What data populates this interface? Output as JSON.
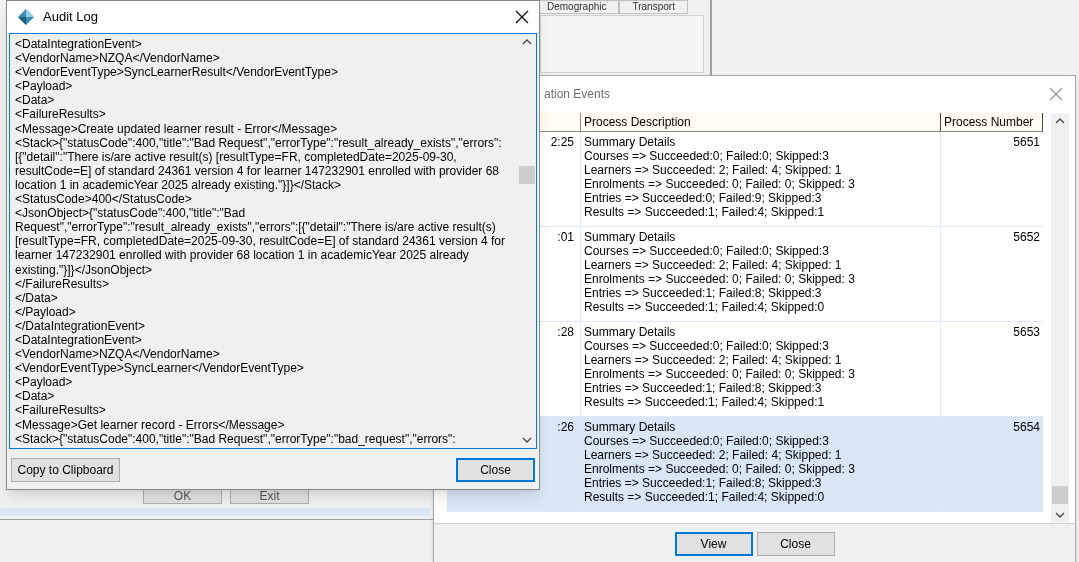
{
  "background": {
    "tabs": [
      "Demographic",
      "Transport"
    ],
    "buttons": [
      "OK",
      "Exit"
    ]
  },
  "events_window": {
    "title": "ation Events",
    "columns": [
      "Process Description",
      "Process Number"
    ],
    "rows": [
      {
        "time": "2:25",
        "title": "Summary Details",
        "details": [
          "Courses => Succeeded:0; Failed:0; Skipped:3",
          "Learners => Succeeded: 2; Failed: 4; Skipped: 1",
          "Enrolments => Succeeded: 0; Failed: 0; Skipped: 3",
          "Entries => Succeeded:0; Failed:9; Skipped:3",
          "Results => Succeeded:1; Failed:4; Skipped:1"
        ],
        "process_number": "5651",
        "selected": false
      },
      {
        "time": ":01",
        "title": "Summary Details",
        "details": [
          "Courses => Succeeded:0; Failed:0; Skipped:3",
          "Learners => Succeeded: 2; Failed: 4; Skipped: 1",
          "Enrolments => Succeeded: 0; Failed: 0; Skipped: 3",
          "Entries => Succeeded:1; Failed:8; Skipped:3",
          "Results => Succeeded:1; Failed:4; Skipped:0"
        ],
        "process_number": "5652",
        "selected": false
      },
      {
        "time": ":28",
        "title": "Summary Details",
        "details": [
          "Courses => Succeeded:0; Failed:0; Skipped:3",
          "Learners => Succeeded: 2; Failed: 4; Skipped: 1",
          "Enrolments => Succeeded: 0; Failed: 0; Skipped: 3",
          "Entries => Succeeded:1; Failed:8; Skipped:3",
          "Results => Succeeded:1; Failed:4; Skipped:1"
        ],
        "process_number": "5653",
        "selected": false
      },
      {
        "time": ":26",
        "title": "Summary Details",
        "details": [
          "Courses => Succeeded:0; Failed:0; Skipped:3",
          "Learners => Succeeded: 2; Failed: 4; Skipped: 1",
          "Enrolments => Succeeded: 0; Failed: 0; Skipped: 3",
          "Entries => Succeeded:1; Failed:8; Skipped:3",
          "Results => Succeeded:1; Failed:4; Skipped:0"
        ],
        "process_number": "5654",
        "selected": true
      }
    ],
    "buttons": [
      {
        "label": "View",
        "default": true
      },
      {
        "label": "Close",
        "default": false
      }
    ]
  },
  "audit_log": {
    "title": "Audit Log",
    "lines": [
      "<DataIntegrationEvent>",
      "<VendorName>NZQA</VendorName>",
      "<VendorEventType>SyncLearnerResult</VendorEventType>",
      "<Payload>",
      "<Data>",
      "<FailureResults>",
      "<Message>Create updated learner result - Error</Message>",
      "<Stack>{\"statusCode\":400,\"title\":\"Bad Request\",\"errorType\":\"result_already_exists\",\"errors\":",
      "[{\"detail\":\"There is/are active result(s) [resultType=FR, completedDate=2025-09-30,",
      "resultCode=E] of standard 24361 version 4 for learner 147232901 enrolled with provider 68",
      "location 1 in academicYear 2025 already existing.\"}]}</Stack>",
      "<StatusCode>400</StatusCode>",
      "<JsonObject>{\"statusCode\":400,\"title\":\"Bad",
      "Request\",\"errorType\":\"result_already_exists\",\"errors\":[{\"detail\":\"There is/are active result(s)",
      "[resultType=FR, completedDate=2025-09-30, resultCode=E] of standard 24361 version 4 for",
      "learner 147232901 enrolled with provider 68 location 1 in academicYear 2025 already",
      "existing.\"}]}</JsonObject>",
      "</FailureResults>",
      "</Data>",
      "</Payload>",
      "</DataIntegrationEvent>",
      "<DataIntegrationEvent>",
      "<VendorName>NZQA</VendorName>",
      "<VendorEventType>SyncLearner</VendorEventType>",
      "<Payload>",
      "<Data>",
      "<FailureResults>",
      "<Message>Get learner record - Errors</Message>",
      "<Stack>{\"statusCode\":400,\"title\":\"Bad Request\",\"errorType\":\"bad_request\",\"errors\":"
    ],
    "buttons": [
      {
        "label": "Copy to Clipboard",
        "default": false
      },
      {
        "label": "Close",
        "default": true
      }
    ]
  }
}
